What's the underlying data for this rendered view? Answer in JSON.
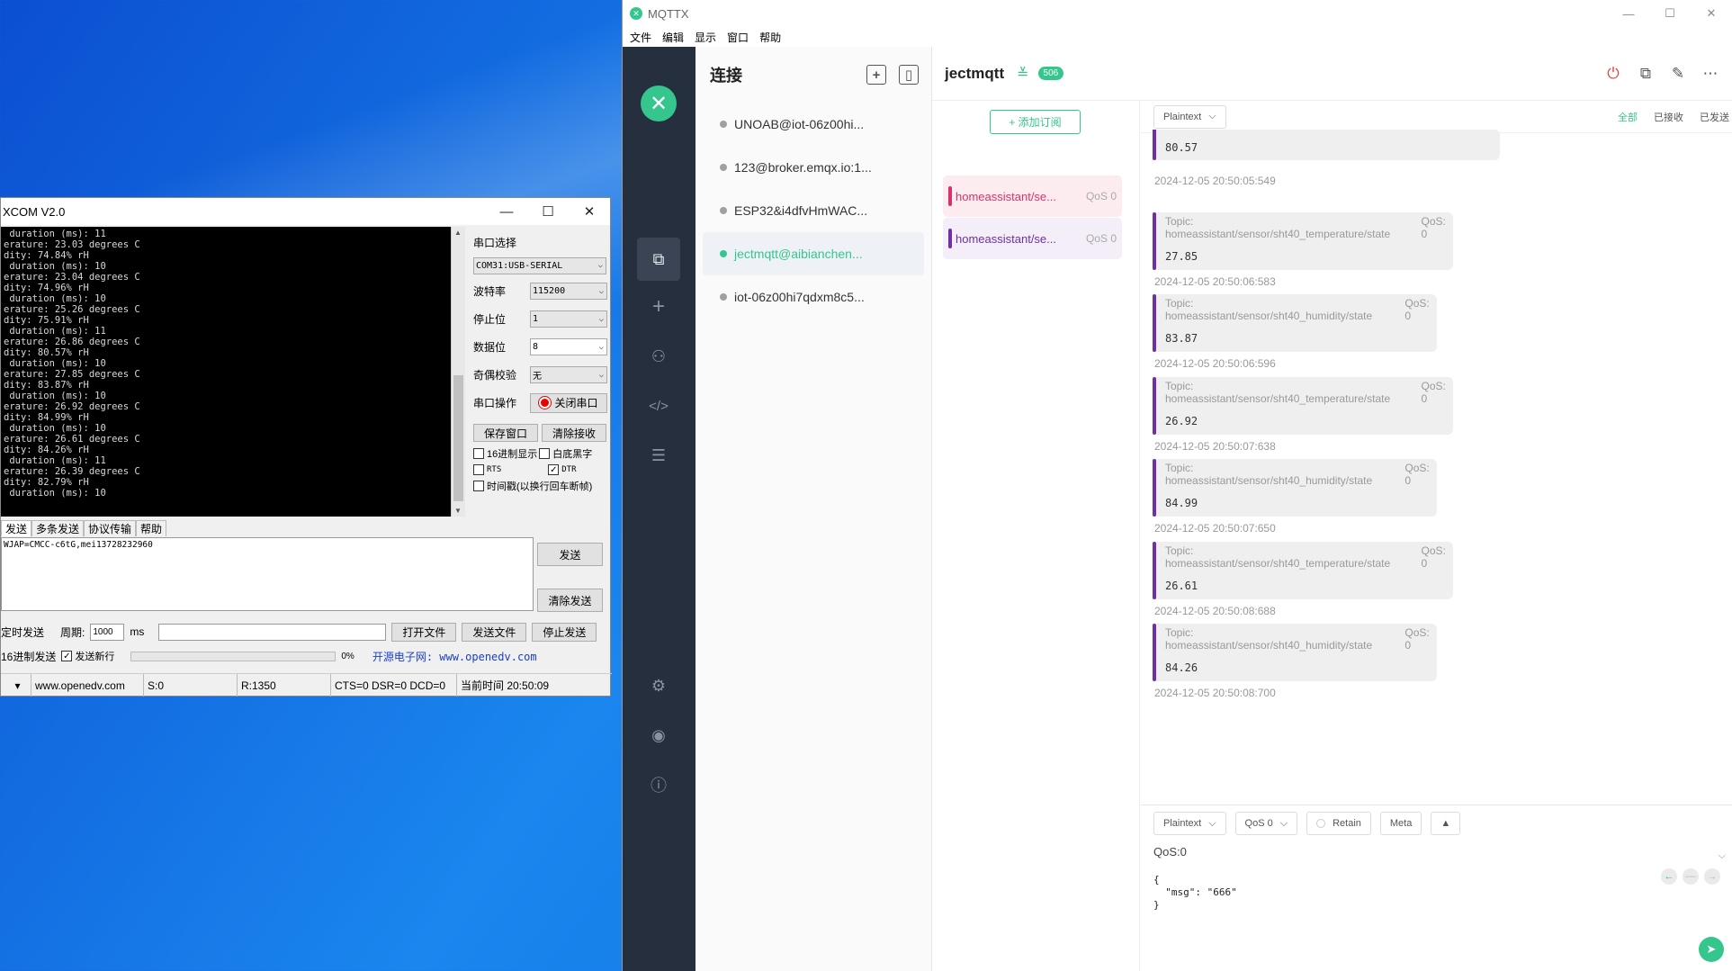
{
  "xcom": {
    "title": "XCOM V2.0",
    "terminal_lines": [
      " duration (ms): 11",
      "erature: 23.03 degrees C",
      "dity: 74.84% rH",
      " duration (ms): 10",
      "erature: 23.04 degrees C",
      "dity: 74.96% rH",
      " duration (ms): 10",
      "erature: 25.26 degrees C",
      "dity: 75.91% rH",
      " duration (ms): 11",
      "erature: 26.86 degrees C",
      "dity: 80.57% rH",
      " duration (ms): 10",
      "erature: 27.85 degrees C",
      "dity: 83.87% rH",
      " duration (ms): 10",
      "erature: 26.92 degrees C",
      "dity: 84.99% rH",
      " duration (ms): 10",
      "erature: 26.61 degrees C",
      "dity: 84.26% rH",
      " duration (ms): 11",
      "erature: 26.39 degrees C",
      "dity: 82.79% rH",
      " duration (ms): 10"
    ],
    "port_label": "串口选择",
    "port_value": "COM31:USB-SERIAL",
    "baud_label": "波特率",
    "baud_value": "115200",
    "stop_label": "停止位",
    "stop_value": "1",
    "data_label": "数据位",
    "data_value": "8",
    "parity_label": "奇偶校验",
    "parity_value": "无",
    "op_label": "串口操作",
    "close_port": "关闭串口",
    "save_window": "保存窗口",
    "clear_recv": "清除接收",
    "hex_display": "16进制显示",
    "white_bg": "白底黑字",
    "rts": "RTS",
    "dtr": "DTR",
    "timestamp": "时间戳(以换行回车断帧)",
    "tabs": [
      "发送",
      "多条发送",
      "协议传输",
      "帮助"
    ],
    "send_text": "WJAP=CMCC-c6tG,mei13728232960",
    "send_btn": "发送",
    "clear_send": "清除发送",
    "timed_send": "定时发送",
    "period_label": "周期:",
    "period_value": "1000",
    "ms": "ms",
    "open_file": "打开文件",
    "send_file": "发送文件",
    "stop_send": "停止发送",
    "hex_send": "16进制发送",
    "send_newline": "发送新行",
    "progress": "0%",
    "site": "开源电子网: www.openedv.com",
    "status": {
      "url": "www.openedv.com",
      "s": "S:0",
      "r": "R:1350",
      "lines": "CTS=0 DSR=0 DCD=0",
      "time": "当前时间 20:50:09"
    }
  },
  "mqttx": {
    "app_title": "MQTTX",
    "menu": [
      "文件",
      "编辑",
      "显示",
      "窗口",
      "帮助"
    ],
    "conn_header": "连接",
    "connections": [
      {
        "name": "UNOAB@iot-06z00hi...",
        "active": false
      },
      {
        "name": "123@broker.emqx.io:1...",
        "active": false
      },
      {
        "name": "ESP32&i4dfvHmWAC...",
        "active": false
      },
      {
        "name": "jectmqtt@aibianchen...",
        "active": true
      },
      {
        "name": "iot-06z00hi7qdxm8c5...",
        "active": false
      }
    ],
    "current_conn": "jectmqtt",
    "msg_count": "506",
    "add_sub": "+ 添加订阅",
    "subscriptions": [
      {
        "topic": "homeassistant/se...",
        "qos": "QoS 0",
        "color": "#d6336c",
        "bg": "#fcecef"
      },
      {
        "topic": "homeassistant/se...",
        "qos": "QoS 0",
        "color": "#6f2fa6",
        "bg": "#f3eef8"
      }
    ],
    "format": "Plaintext",
    "filters": [
      "全部",
      "已接收",
      "已发送"
    ],
    "first_payload": "80.57",
    "first_time": "2024-12-05 20:50:05:549",
    "messages": [
      {
        "topic": "Topic: homeassistant/sensor/sht40_temperature/state",
        "qos": "QoS: 0",
        "payload": "27.85",
        "time": "2024-12-05 20:50:06:583"
      },
      {
        "topic": "Topic: homeassistant/sensor/sht40_humidity/state",
        "qos": "QoS: 0",
        "payload": "83.87",
        "time": "2024-12-05 20:50:06:596"
      },
      {
        "topic": "Topic: homeassistant/sensor/sht40_temperature/state",
        "qos": "QoS: 0",
        "payload": "26.92",
        "time": "2024-12-05 20:50:07:638"
      },
      {
        "topic": "Topic: homeassistant/sensor/sht40_humidity/state",
        "qos": "QoS: 0",
        "payload": "84.99",
        "time": "2024-12-05 20:50:07:650"
      },
      {
        "topic": "Topic: homeassistant/sensor/sht40_temperature/state",
        "qos": "QoS: 0",
        "payload": "26.61",
        "time": "2024-12-05 20:50:08:688"
      },
      {
        "topic": "Topic: homeassistant/sensor/sht40_humidity/state",
        "qos": "QoS: 0",
        "payload": "84.26",
        "time": "2024-12-05 20:50:08:700"
      }
    ],
    "composer": {
      "format": "Plaintext",
      "qos": "QoS 0",
      "retain": "Retain",
      "meta": "Meta",
      "qos_line": "QoS:0",
      "payload": "{\n  \"msg\": \"666\"\n}"
    }
  }
}
